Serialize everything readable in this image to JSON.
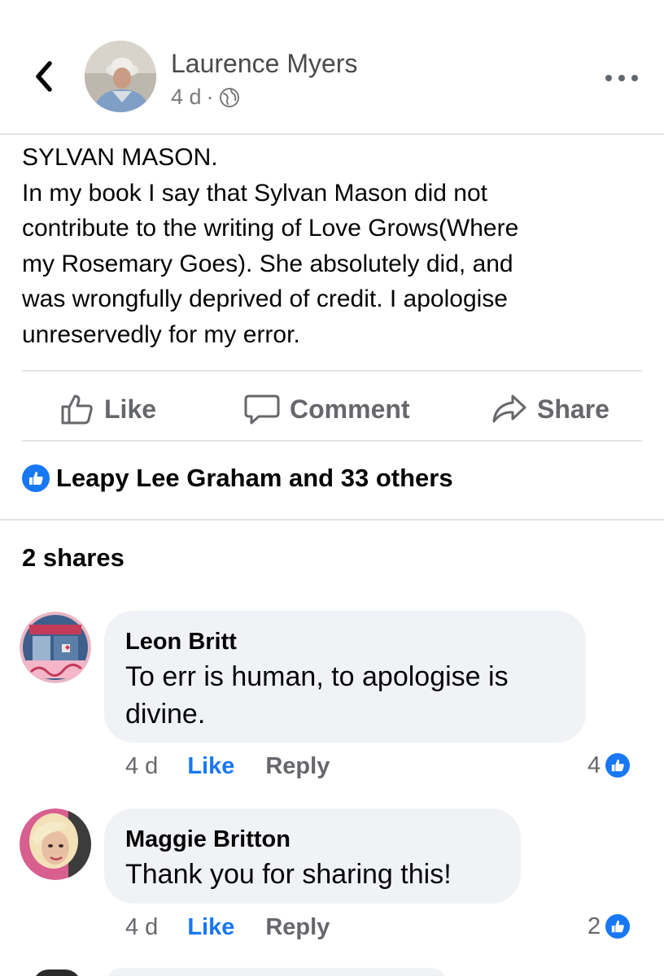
{
  "post": {
    "author_name": "Laurence Myers",
    "timestamp": "4 d",
    "separator": "·",
    "privacy_icon": "globe-icon",
    "body_lines": [
      "SYLVAN MASON.",
      "In my book I say that Sylvan Mason did not",
      "contribute to the writing of Love Grows(Where",
      "my Rosemary Goes). She absolutely did, and",
      "was wrongfully deprived of credit. I apologise",
      "unreservedly for my error."
    ]
  },
  "actions": {
    "like_label": "Like",
    "comment_label": "Comment",
    "share_label": "Share"
  },
  "reactions": {
    "summary": "Leapy Lee Graham and 33 others",
    "icon": "like-icon"
  },
  "shares_text": "2 shares",
  "comments": [
    {
      "name": "Leon Britt",
      "text_lines": [
        "To err is human, to apologise is",
        "divine."
      ],
      "time": "4 d",
      "like_label": "Like",
      "reply_label": "Reply",
      "reaction_count": "4"
    },
    {
      "name": "Maggie Britton",
      "text_lines": [
        "Thank you for sharing this!"
      ],
      "time": "4 d",
      "like_label": "Like",
      "reply_label": "Reply",
      "reaction_count": "2"
    }
  ],
  "colors": {
    "accent": "#1877f2",
    "secondary_text": "#65676b",
    "bubble": "#f0f2f5"
  }
}
